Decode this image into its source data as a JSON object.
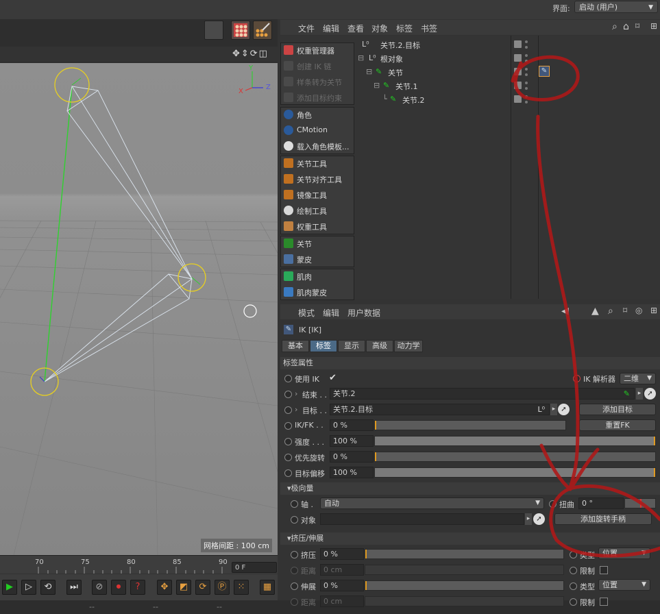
{
  "topbar": {
    "layout_label": "界面:",
    "layout_value": "启动 (用户)"
  },
  "viewport": {
    "grid_label": "网格间距 : 100 cm",
    "axis_y": "Y",
    "axis_x": "X",
    "axis_z": "Z"
  },
  "timeline": {
    "ticks": [
      "70",
      "75",
      "80",
      "85",
      "90"
    ],
    "frame": "0 F"
  },
  "object_manager": {
    "menu": [
      "文件",
      "编辑",
      "查看",
      "对象",
      "标签",
      "书签"
    ],
    "rows": [
      {
        "name": "关节.2.目标",
        "icon": "null-icon"
      },
      {
        "name": "根对象",
        "icon": "null-icon"
      },
      {
        "name": "关节",
        "icon": "joint-icon",
        "tag": "ik-tag-icon"
      },
      {
        "name": "关节.1",
        "icon": "joint-icon"
      },
      {
        "name": "关节.2",
        "icon": "joint-icon"
      }
    ]
  },
  "palette": {
    "items": [
      {
        "label": "权重管理器",
        "icon": "weight-manager-icon",
        "enabled": true
      },
      {
        "label": "创建 IK 链",
        "icon": "ik-chain-icon",
        "enabled": false
      },
      {
        "label": "样条转为关节",
        "icon": "spline-to-joint-icon",
        "enabled": false
      },
      {
        "label": "添加目标约束",
        "icon": "aim-constraint-icon",
        "enabled": false
      },
      {
        "label": "角色",
        "icon": "character-icon",
        "enabled": true
      },
      {
        "label": "CMotion",
        "icon": "cmotion-icon",
        "enabled": true
      },
      {
        "label": "载入角色模板...",
        "icon": "load-template-icon",
        "enabled": true
      },
      {
        "label": "关节工具",
        "icon": "joint-tool-icon",
        "enabled": true
      },
      {
        "label": "关节对齐工具",
        "icon": "joint-align-icon",
        "enabled": true
      },
      {
        "label": "镜像工具",
        "icon": "mirror-tool-icon",
        "enabled": true
      },
      {
        "label": "绘制工具",
        "icon": "paint-tool-icon",
        "enabled": true
      },
      {
        "label": "权重工具",
        "icon": "weight-tool-icon",
        "enabled": true
      },
      {
        "label": "关节",
        "icon": "joint-icon",
        "enabled": true
      },
      {
        "label": "蒙皮",
        "icon": "skin-icon",
        "enabled": true
      },
      {
        "label": "肌肉",
        "icon": "muscle-icon",
        "enabled": true
      },
      {
        "label": "肌肉蒙皮",
        "icon": "muscle-skin-icon",
        "enabled": true
      }
    ]
  },
  "attributes": {
    "menu": [
      "模式",
      "编辑",
      "用户数据"
    ],
    "title": "IK [IK]",
    "tabs": [
      "基本",
      "标签",
      "显示",
      "高级",
      "动力学"
    ],
    "active_tab": "标签",
    "section_tag": "标签属性",
    "use_ik_label": "使用 IK",
    "solver_label": "IK 解析器",
    "solver_value": "二维",
    "end_label": "结束 . .",
    "end_value": "关节.2",
    "target_label": "目标 . .",
    "target_value": "关节.2.目标",
    "add_target_button": "添加目标",
    "ikfk_label": "IK/FK . .",
    "ikfk_value": "0 %",
    "ikfk_level": 0,
    "reset_fk_button": "重置FK",
    "strength_label": "强度 . . .",
    "strength_value": "100 %",
    "strength_level": 1.0,
    "prefer_rotation_label": "优先旋转",
    "prefer_rotation_value": "0 %",
    "prefer_rotation_level": 0,
    "target_offset_label": "目标偏移",
    "target_offset_value": "100 %",
    "target_offset_level": 1.0,
    "section_pole": "极向量",
    "axis_label": "轴 .",
    "axis_value": "自动",
    "twist_label": "扭曲",
    "twist_value": "0 °",
    "object_label": "对象",
    "add_handle_button": "添加旋转手柄",
    "section_squash": "挤压/伸展",
    "squash_label": "挤压",
    "squash_value": "0 %",
    "type_label": "类型",
    "type_value": "位置",
    "distance_label": "距离",
    "distance_value": "0 cm",
    "limit_label": "限制",
    "stretch_label": "伸展",
    "stretch_value": "0 %",
    "type2_value": "位置",
    "distance2_value": "0 cm",
    "limit2_label": "限制"
  },
  "statusbar": {
    "cells": [
      "--",
      "--",
      "--"
    ]
  },
  "colors": {
    "accent": "#4b6a86",
    "joint_ring": "#e8d020",
    "annotation": "#b01818"
  }
}
